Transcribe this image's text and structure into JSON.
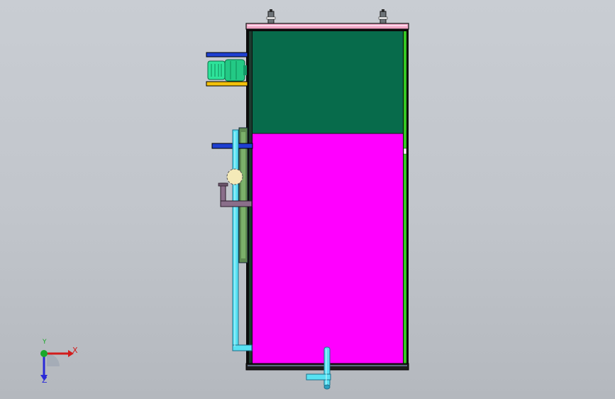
{
  "viewport": {
    "background_top": "#c9cdd3",
    "background_bottom": "#b4b8be"
  },
  "model": {
    "frame_color": "#0b0b0b",
    "top_rail_color": "#f2a6c6",
    "upper_chamber_color": "#076b4b",
    "lower_chamber_color": "#ff00ff",
    "right_strip_color": "#35c823",
    "motor_color": "#2ee39a",
    "pipe_color": "#58e1f2",
    "valve_color": "#f4eab8",
    "bracket_blue_color": "#1e3fd1",
    "bracket_yellow_color": "#f3c10a",
    "side_panel_color": "#5e8a50",
    "elbow_pipe_color": "#8a6e8a"
  },
  "triad": {
    "x_label": "X",
    "y_label": "Y",
    "z_label": "Z",
    "x_color": "#d21c1c",
    "y_color": "#1aa82a",
    "z_color": "#2a2ad8"
  }
}
